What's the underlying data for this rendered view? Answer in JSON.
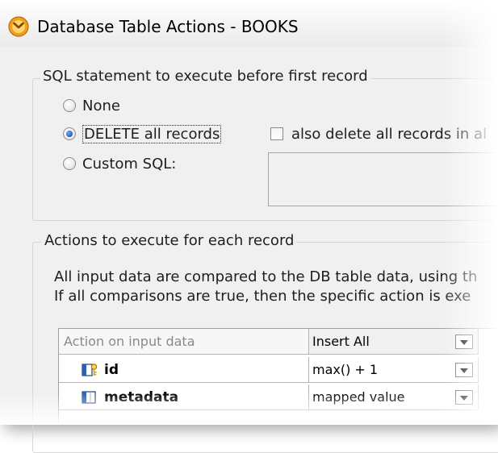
{
  "window": {
    "title": "Database Table Actions - BOOKS"
  },
  "pre_sql_group": {
    "legend": "SQL statement to execute before first record",
    "options": [
      {
        "label": "None",
        "checked": false
      },
      {
        "label": "DELETE all records",
        "checked": true
      },
      {
        "label": "Custom SQL:",
        "checked": false
      }
    ],
    "also_delete_checkbox": {
      "label": "also delete all records in al",
      "checked": false
    },
    "custom_sql_value": ""
  },
  "actions_group": {
    "legend": "Actions to execute for each record",
    "description_line1": "All input data are compared to the DB table data, using th",
    "description_line2": "If all comparisons are true, then the specific action is exe",
    "grid": {
      "header_label": "Action on input data",
      "header_value": "Insert All",
      "rows": [
        {
          "field": "id",
          "icon": "primary-key-field-icon",
          "value": "max() + 1"
        },
        {
          "field": "metadata",
          "icon": "column-field-icon",
          "value": "mapped value"
        }
      ]
    }
  }
}
